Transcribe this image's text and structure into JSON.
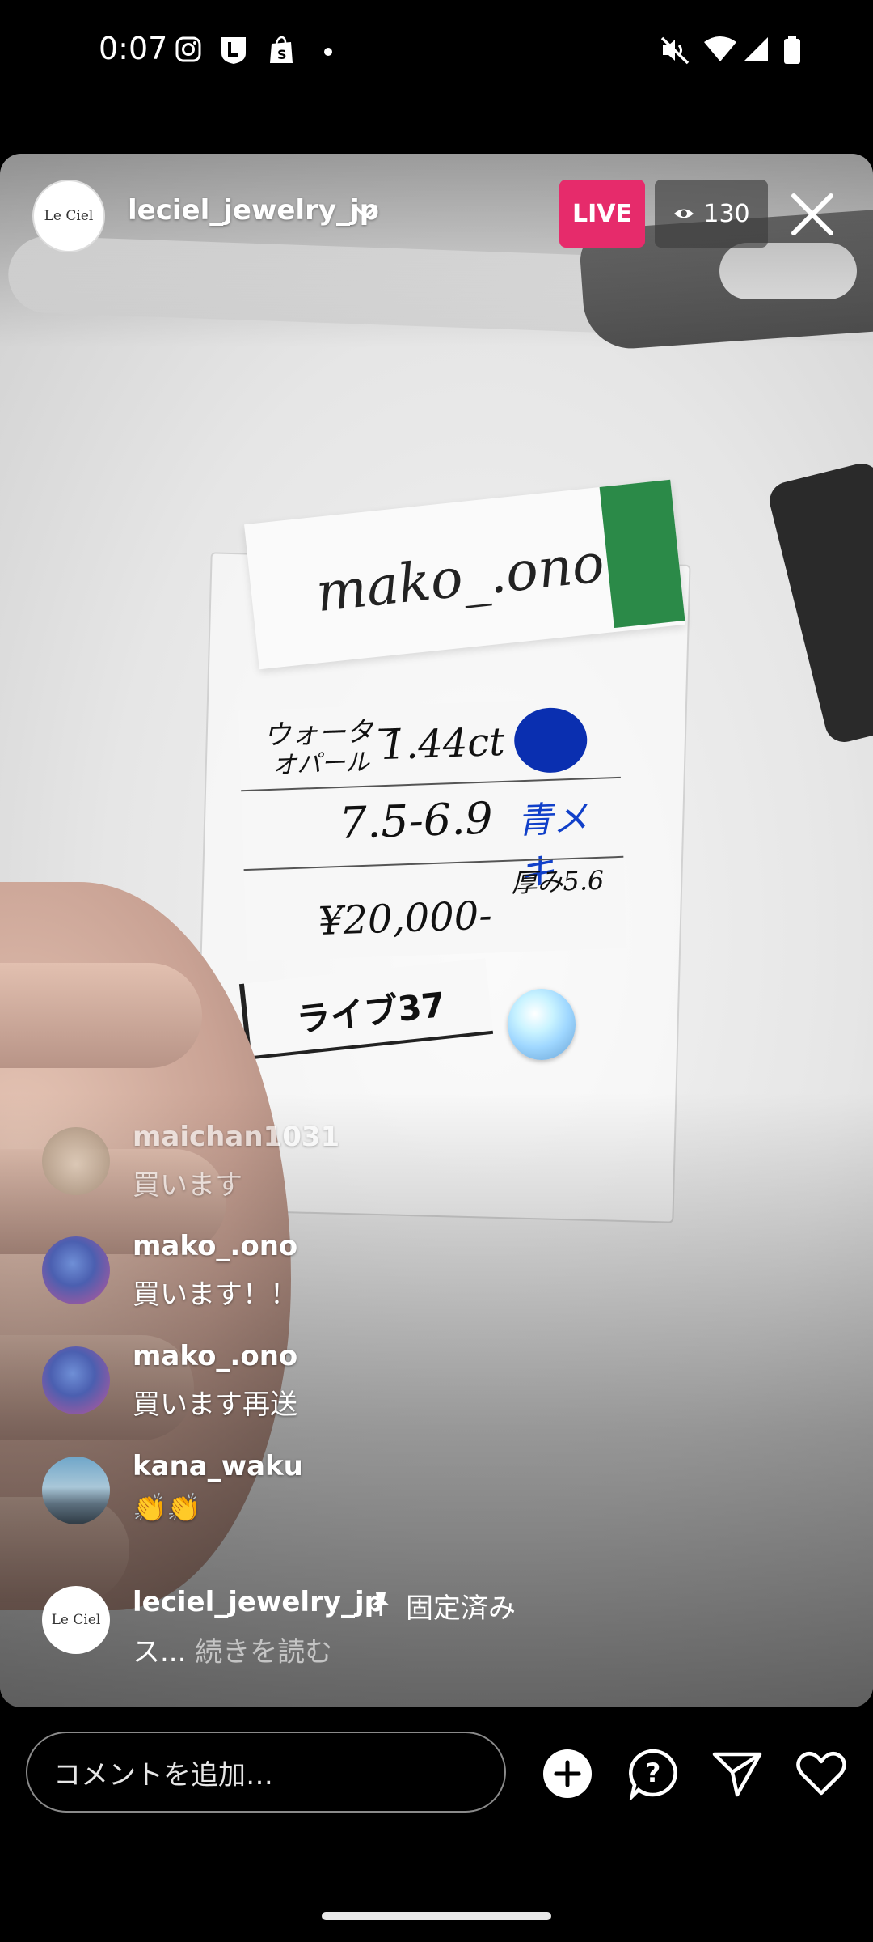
{
  "status_bar": {
    "time": "0:07",
    "notification_icons": [
      "instagram-icon",
      "l-app-icon",
      "shopify-icon",
      "dot-icon"
    ],
    "system_icons": [
      "mute-icon",
      "wifi-icon",
      "signal-icon",
      "battery-icon"
    ]
  },
  "header": {
    "account_name": "leciel_jewelry_jp",
    "avatar_text": "Le Ciel",
    "live_label": "LIVE",
    "viewer_count": "130"
  },
  "comments": [
    {
      "user": "maichan1031",
      "text": "買います"
    },
    {
      "user": "mako_.ono",
      "text": "買います！！"
    },
    {
      "user": "mako_.ono",
      "text": "買います再送"
    },
    {
      "user": "kana_waku",
      "text": "👏👏"
    }
  ],
  "pinned": {
    "user": "leciel_jewelry_jp",
    "pinned_label": "固定済み",
    "text": "ス...",
    "more_label": "続きを読む",
    "avatar_text": "Le Ciel"
  },
  "scene": {
    "name_card": "mako_.ono",
    "info_line1a": "ウォーター",
    "info_line1b": "オパール",
    "info_carat": "1.44ct",
    "info_size": "7.5-6.9",
    "info_color": "青メキ",
    "info_thickness": "厚み5.6",
    "info_price": "¥20,000-",
    "live_tag": "ライブ37"
  },
  "bottom_bar": {
    "comment_placeholder": "コメントを追加…",
    "icons": [
      "add-circle-icon",
      "question-icon",
      "send-icon",
      "heart-icon"
    ]
  },
  "colors": {
    "live_badge": "#e62b6b",
    "background": "#000000"
  }
}
